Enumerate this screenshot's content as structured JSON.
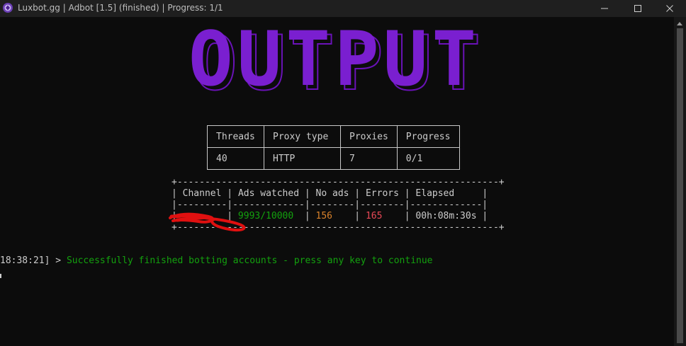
{
  "window": {
    "title": "Luxbot.gg | Adbot [1.5] (finished) | Progress: 1/1",
    "icon": "luxbot-app-icon"
  },
  "banner": {
    "text": "OUTPUT",
    "color": "#7a1fd0"
  },
  "info_table": {
    "headers": [
      "Threads",
      "Proxy type",
      "Proxies",
      "Progress"
    ],
    "values": [
      "40",
      "HTTP",
      "7",
      "0/1"
    ]
  },
  "stats_table": {
    "border": "+----------------------------------------------------------+",
    "headers": [
      "Channel",
      "Ads watched",
      "No ads",
      "Errors",
      "Elapsed"
    ],
    "separator": "|---------|-------------|--------|--------|-------------|",
    "row": {
      "channel": "",
      "ads_watched": "9993/10000",
      "no_ads": "156",
      "errors": "165",
      "elapsed": "00h:08m:30s"
    },
    "colors": {
      "ads_watched": "#13a10e",
      "no_ads": "#d9822b",
      "errors": "#e74856"
    }
  },
  "log": {
    "timestamp": "18:38:21]",
    "prompt": " > ",
    "message": "Successfully finished botting accounts - press any key to continue",
    "message_color": "#13a10e"
  }
}
